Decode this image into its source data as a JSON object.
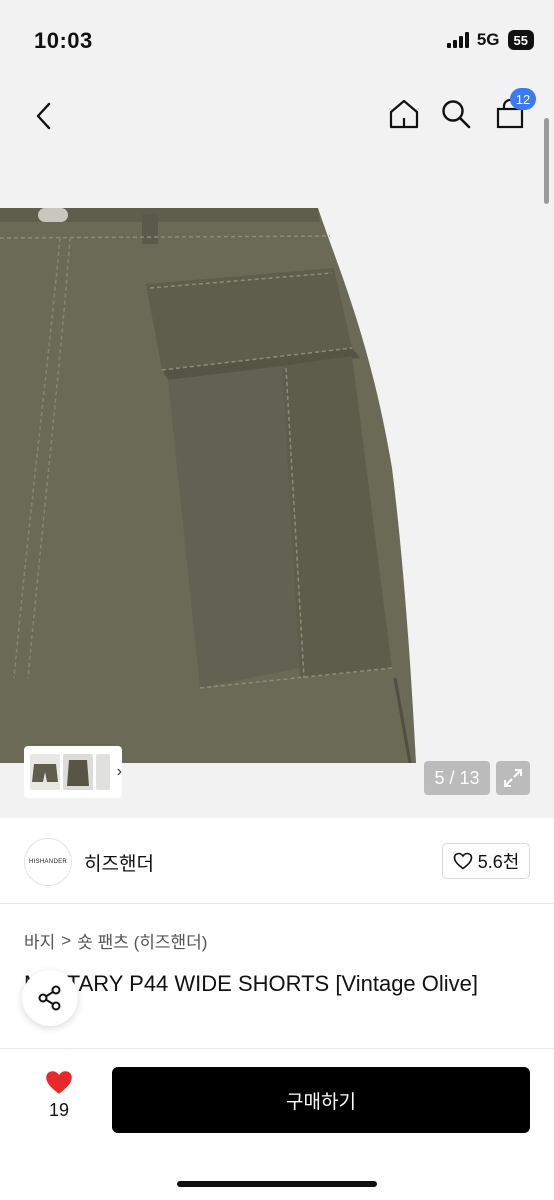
{
  "status_bar": {
    "time": "10:03",
    "network": "5G",
    "battery": "55"
  },
  "header": {
    "cart_count": "12"
  },
  "gallery": {
    "page_indicator": "5 / 13"
  },
  "brand": {
    "logo_text": "HISHANDER",
    "name": "히즈핸더",
    "likes": "5.6천"
  },
  "breadcrumb": {
    "category": "바지",
    "separator": ">",
    "subcategory": "숏 팬츠 (히즈핸더)"
  },
  "product": {
    "title": "MILITARY P44 WIDE SHORTS [Vintage Olive]"
  },
  "bottom_bar": {
    "wish_count": "19",
    "buy_label": "구매하기"
  },
  "colors": {
    "accent": "#3a7bf4",
    "fabric": "#6b6a58",
    "heart": "#e8282b"
  }
}
